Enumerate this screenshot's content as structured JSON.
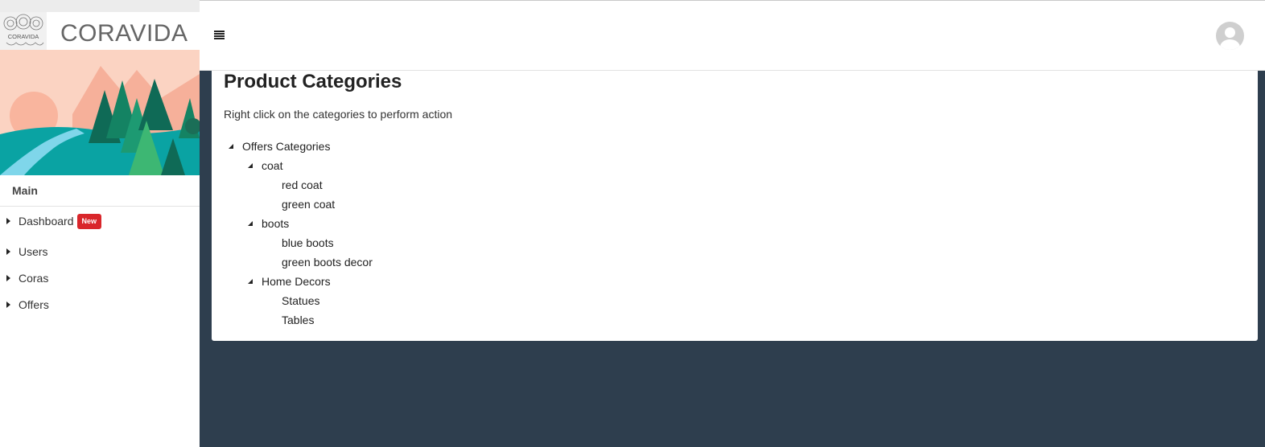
{
  "brand": {
    "name": "CORAVIDA",
    "logo_text": "CORAVIDA"
  },
  "sidebar": {
    "heading": "Main",
    "items": [
      {
        "label": "Dashboard",
        "badge": "New"
      },
      {
        "label": "Users"
      },
      {
        "label": "Coras"
      },
      {
        "label": "Offers"
      }
    ]
  },
  "header": {
    "menu_icon": "hamburger-icon",
    "avatar_icon": "user-avatar-icon"
  },
  "main": {
    "title": "Product Categories",
    "hint": "Right click on the categories to perform action",
    "tree": {
      "root": "Offers Categories",
      "groups": [
        {
          "label": "coat",
          "children": [
            "red coat",
            "green coat"
          ]
        },
        {
          "label": "boots",
          "children": [
            "blue boots",
            "green boots decor"
          ]
        },
        {
          "label": "Home Decors",
          "children": [
            "Statues",
            "Tables"
          ]
        }
      ]
    }
  },
  "colors": {
    "badge": "#d9262b",
    "content_bg": "#2e3e4e",
    "card_bg": "#ffffff"
  }
}
